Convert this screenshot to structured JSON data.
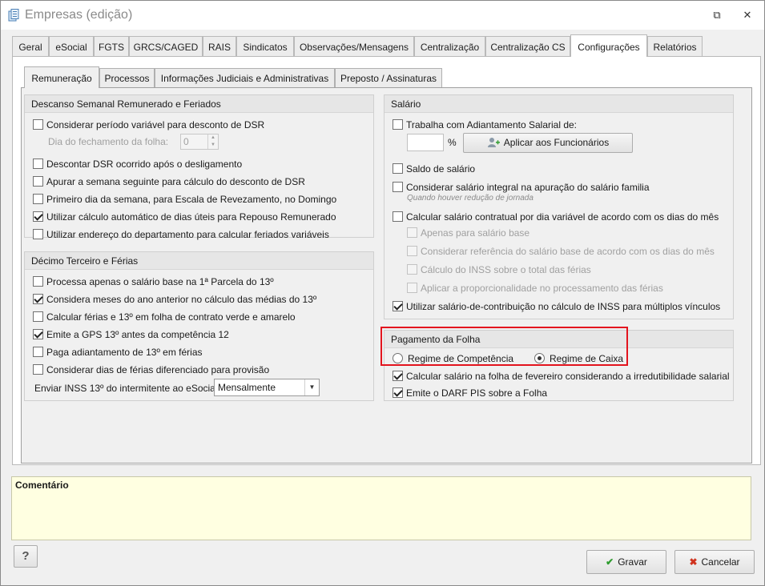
{
  "window": {
    "title": "Empresas (edição)",
    "restore_glyph": "⧉",
    "close_glyph": "✕"
  },
  "main_tabs": [
    "Geral",
    "eSocial",
    "FGTS",
    "GRCS/CAGED",
    "RAIS",
    "Sindicatos",
    "Observações/Mensagens",
    "Centralização",
    "Centralização CS",
    "Configurações",
    "Relatórios"
  ],
  "sub_tabs": [
    "Remuneração",
    "Processos",
    "Informações Judiciais e Administrativas",
    "Preposto / Assinaturas"
  ],
  "dsr": {
    "title": "Descanso Semanal Remunerado e Feriados",
    "items": [
      {
        "label": "Considerar período variável para desconto de DSR",
        "checked": false
      },
      {
        "label": "Descontar DSR ocorrido após o desligamento",
        "checked": false
      },
      {
        "label": "Apurar a semana seguinte para cálculo do desconto de DSR",
        "checked": false
      },
      {
        "label": "Primeiro dia da semana, para Escala de Revezamento, no Domingo",
        "checked": false
      },
      {
        "label": "Utilizar cálculo automático de dias úteis para Repouso Remunerado",
        "checked": true
      },
      {
        "label": "Utilizar endereço do departamento para calcular feriados variáveis",
        "checked": false
      }
    ],
    "dia_label": "Dia do fechamento da folha:",
    "dia_value": "0"
  },
  "decimo": {
    "title": "Décimo Terceiro e Férias",
    "items": [
      {
        "label": "Processa apenas o salário base na 1ª Parcela do 13º",
        "checked": false
      },
      {
        "label": "Considera meses do ano anterior no cálculo das médias do 13º",
        "checked": true
      },
      {
        "label": "Calcular férias e 13º em folha de contrato verde e amarelo",
        "checked": false
      },
      {
        "label": "Emite a GPS 13º antes da competência 12",
        "checked": true
      },
      {
        "label": "Paga adiantamento de 13º em férias",
        "checked": false
      },
      {
        "label": "Considerar dias de férias diferenciado para provisão",
        "checked": false
      }
    ],
    "inss_label": "Enviar INSS 13º do intermitente ao eSocial",
    "inss_value": "Mensalmente"
  },
  "salario": {
    "title": "Salário",
    "adiant_label": "Trabalha com Adiantamento Salarial de:",
    "percent": "%",
    "apply_button": "Aplicar aos Funcionários",
    "saldo": "Saldo de salário",
    "integral": "Considerar salário integral na apuração do salário familia",
    "integral_hint": "Quando houver redução de jornada",
    "contratual": "Calcular salário contratual por dia variável de acordo com os dias do mês",
    "sub_items": [
      "Apenas para salário base",
      "Considerar referência do salário base de acordo com os dias do mês",
      "Cálculo do INSS sobre o total das férias",
      "Aplicar a proporcionalidade no processamento das férias"
    ],
    "multiplos": "Utilizar salário-de-contribuição no cálculo de INSS para múltiplos vínculos"
  },
  "pagamento": {
    "title": "Pagamento da Folha",
    "radio1": "Regime de Competência",
    "radio2": "Regime de Caixa",
    "fevereiro": "Calcular salário na folha de fevereiro considerando a irredutibilidade salarial",
    "darf": "Emite o DARF PIS sobre a Folha"
  },
  "comment": {
    "label": "Comentário"
  },
  "footer": {
    "help": "?",
    "save": "Gravar",
    "cancel": "Cancelar"
  }
}
